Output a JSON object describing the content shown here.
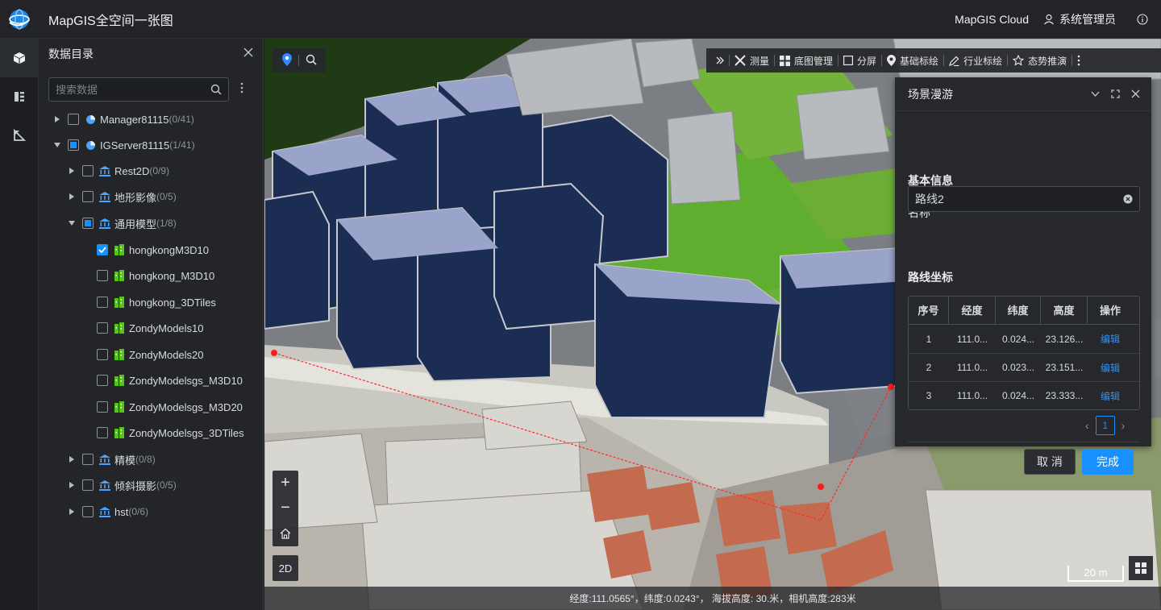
{
  "header": {
    "title": "MapGIS全空间一张图",
    "brand": "MapGIS Cloud",
    "user": "系统管理员"
  },
  "rail": {
    "items": [
      "cube-icon",
      "catalog-icon",
      "plot-icon"
    ]
  },
  "catalog": {
    "title": "数据目录",
    "search_placeholder": "搜索数据",
    "nodes": [
      {
        "label": "Manager81115",
        "count": "(0/41)"
      },
      {
        "label": "IGServer81115",
        "count": "(1/41)"
      },
      {
        "label": "Rest2D",
        "count": "(0/9)"
      },
      {
        "label": "地形影像",
        "count": "(0/5)"
      },
      {
        "label": "通用模型",
        "count": "(1/8)"
      },
      {
        "label": "hongkongM3D10",
        "count": ""
      },
      {
        "label": "hongkong_M3D10",
        "count": ""
      },
      {
        "label": "hongkong_3DTiles",
        "count": ""
      },
      {
        "label": "ZondyModels10",
        "count": ""
      },
      {
        "label": "ZondyModels20",
        "count": ""
      },
      {
        "label": "ZondyModelsgs_M3D10",
        "count": ""
      },
      {
        "label": "ZondyModelsgs_M3D20",
        "count": ""
      },
      {
        "label": "ZondyModelsgs_3DTiles",
        "count": ""
      },
      {
        "label": "精模",
        "count": "(0/8)"
      },
      {
        "label": "倾斜摄影",
        "count": "(0/5)"
      },
      {
        "label": "hst",
        "count": "(0/6)"
      }
    ]
  },
  "toolbar": {
    "items": [
      "测量",
      "底图管理",
      "分屏",
      "基础标绘",
      "行业标绘",
      "态势推演"
    ]
  },
  "map_controls": {
    "zoom_in": "+",
    "zoom_out": "−",
    "mode_2d": "2D",
    "scale": "20 m"
  },
  "status": {
    "text": "经度:111.0565°，纬度:0.0243°， 海拔高度: 30.米，相机高度:283米"
  },
  "roam_panel": {
    "title": "场景漫游",
    "basic_info": "基本信息",
    "name_label": "名称",
    "name_value": "路线2",
    "coords_title": "路线坐标",
    "columns": [
      "序号",
      "经度",
      "纬度",
      "高度",
      "操作"
    ],
    "rows": [
      {
        "idx": "1",
        "lon": "111.0...",
        "lat": "0.024...",
        "alt": "23.126...",
        "action": "编辑"
      },
      {
        "idx": "2",
        "lon": "111.0...",
        "lat": "0.023...",
        "alt": "23.151...",
        "action": "编辑"
      },
      {
        "idx": "3",
        "lon": "111.0...",
        "lat": "0.024...",
        "alt": "23.333...",
        "action": "编辑"
      }
    ],
    "page": "1",
    "cancel": "取 消",
    "done": "完成"
  }
}
